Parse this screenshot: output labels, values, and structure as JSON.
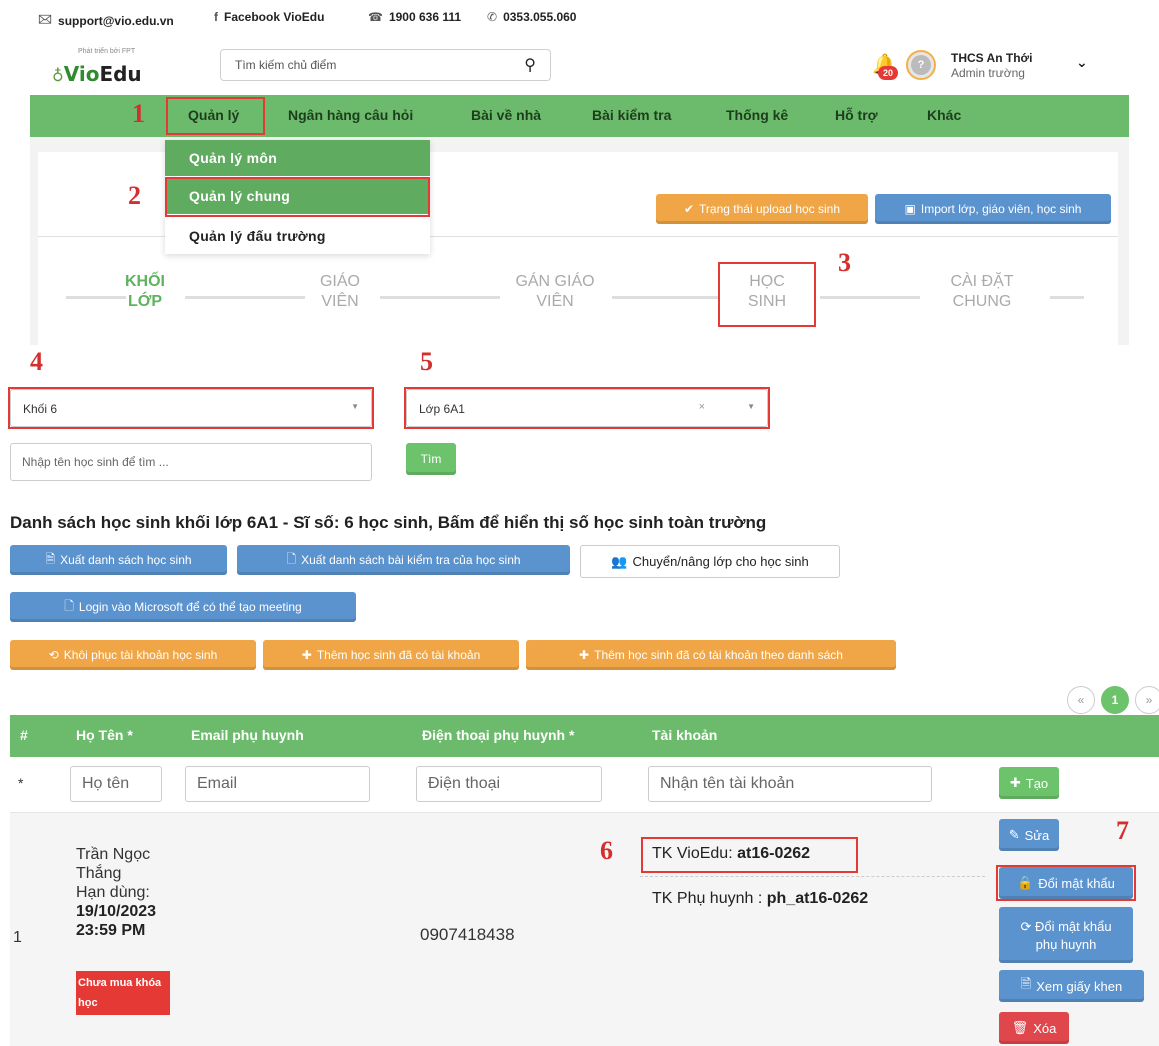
{
  "topbar": {
    "email": "support@vio.edu.vn",
    "facebook": "Facebook VioEdu",
    "hotline": "1900 636 111",
    "phone": "0353.055.060"
  },
  "header": {
    "logo_tag": "Phát triển bởi FPT",
    "logo_text_a": "Vio",
    "logo_text_b": "Edu",
    "search_placeholder": "Tìm kiếm chủ điểm",
    "notification_count": "20",
    "user_name": "THCS An Thới",
    "user_role": "Admin trường"
  },
  "nav": {
    "items": [
      "Quản lý",
      "Ngân hàng câu hỏi",
      "Bài về nhà",
      "Bài kiểm tra",
      "Thống kê",
      "Hỗ trợ",
      "Khác"
    ]
  },
  "dropdown": {
    "items": [
      "Quản lý môn",
      "Quản lý chung",
      "Quản lý đấu trường"
    ]
  },
  "panel_buttons": {
    "upload_status": "Trạng thái upload học sinh",
    "import": "Import lớp, giáo viên, học sinh"
  },
  "steps": [
    {
      "line1": "KHỐI",
      "line2": "LỚP"
    },
    {
      "line1": "GIÁO",
      "line2": "VIÊN"
    },
    {
      "line1": "GÁN GIÁO",
      "line2": "VIÊN"
    },
    {
      "line1": "HỌC",
      "line2": "SINH"
    },
    {
      "line1": "CÀI ĐẶT",
      "line2": "CHUNG"
    }
  ],
  "annotations": [
    "1",
    "2",
    "3",
    "4",
    "5",
    "6",
    "7"
  ],
  "filters": {
    "grade": "Khối 6",
    "class": "Lớp 6A1",
    "clear": "×",
    "student_search_placeholder": "Nhập tên học sinh để tìm ...",
    "search_button": "Tìm"
  },
  "heading": "Danh sách học sinh khối lớp 6A1 - Sĩ số: 6 học sinh, Bấm để hiển thị số học sinh toàn trường",
  "actions": {
    "export_students": "Xuất danh sách học sinh",
    "export_tests": "Xuất danh sách bài kiểm tra của học sinh",
    "transfer": "Chuyển/nâng lớp cho học sinh",
    "microsoft_login": "Login vào Microsoft để có thể tạo meeting",
    "restore": "Khôi phục tài khoản học sinh",
    "add_existing": "Thêm học sinh đã có tài khoản",
    "add_existing_list": "Thêm học sinh đã có tài khoản theo danh sách"
  },
  "pagination": {
    "prev": "«",
    "current": "1",
    "next": "»"
  },
  "table": {
    "headers": [
      "#",
      "Họ Tên *",
      "Email phụ huynh",
      "Điện thoại phụ huynh *",
      "Tài khoản"
    ],
    "filter_row": {
      "marker": "*",
      "name_placeholder": "Họ tên",
      "email_placeholder": "Email",
      "phone_placeholder": "Điện thoại",
      "account_placeholder": "Nhận tên tài khoản",
      "create_button": "Tạo"
    },
    "rows": [
      {
        "index": "1",
        "name_line1": "Trần Ngọc",
        "name_line2": "Thắng",
        "expiry_label": "Hạn dùng:",
        "expiry_date": "19/10/2023",
        "expiry_time": "23:59 PM",
        "status_tag_line1": "Chưa mua khóa",
        "status_tag_line2": "học",
        "phone": "0907418438",
        "account_label": "TK VioEdu:",
        "account_value": "at16-0262",
        "parent_label": "TK Phụ huynh :",
        "parent_value": "ph_at16-0262",
        "buttons": {
          "edit": "Sửa",
          "change_password": "Đổi mật khẩu",
          "change_parent_password_1": "Đổi mật khẩu",
          "change_parent_password_2": "phụ huynh",
          "certificate": "Xem giấy khen",
          "delete": "Xóa"
        }
      }
    ]
  },
  "colors": {
    "nav_green": "#6cbb6c",
    "annotation_red": "#e53935",
    "button_orange": "#f0a646",
    "button_blue": "#5b93cf"
  }
}
